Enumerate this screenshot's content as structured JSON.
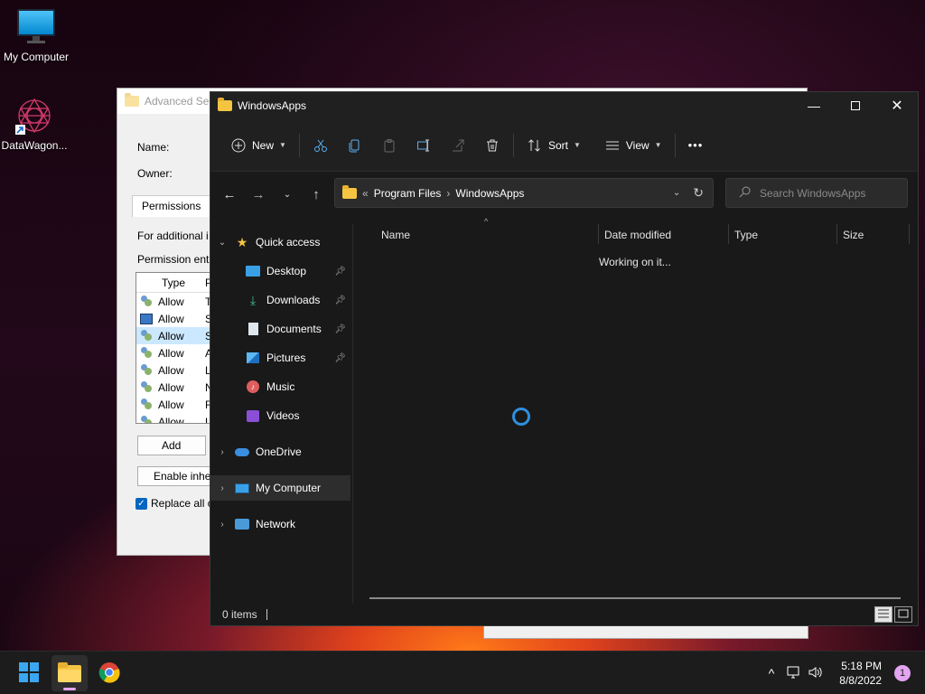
{
  "desktop": {
    "icons": [
      {
        "label": "My Computer"
      },
      {
        "label": "DataWagon..."
      }
    ]
  },
  "background_dialog": {
    "title": "Advanced Sec",
    "name_label": "Name:",
    "owner_label": "Owner:",
    "tab": "Permissions",
    "info_text": "For additional i",
    "entries_label": "Permission entr",
    "list_header": "Type",
    "list_header2": "P",
    "rows": [
      {
        "type": "Allow",
        "p": "T"
      },
      {
        "type": "Allow",
        "p": "S"
      },
      {
        "type": "Allow",
        "p": "S"
      },
      {
        "type": "Allow",
        "p": "A"
      },
      {
        "type": "Allow",
        "p": "L"
      },
      {
        "type": "Allow",
        "p": "N"
      },
      {
        "type": "Allow",
        "p": "R"
      },
      {
        "type": "Allow",
        "p": "L"
      }
    ],
    "add_button": "Add",
    "enable_button": "Enable inhe",
    "replace_checkbox": "Replace all c"
  },
  "explorer": {
    "title": "WindowsApps",
    "toolbar": {
      "new_label": "New",
      "sort_label": "Sort",
      "view_label": "View",
      "more_label": "•••"
    },
    "address": {
      "prefix": "«",
      "crumbs": [
        "Program Files",
        "WindowsApps"
      ]
    },
    "search": {
      "placeholder": "Search WindowsApps"
    },
    "nav": {
      "quick_access": "Quick access",
      "desktop": "Desktop",
      "downloads": "Downloads",
      "documents": "Documents",
      "pictures": "Pictures",
      "music": "Music",
      "videos": "Videos",
      "onedrive": "OneDrive",
      "my_computer": "My Computer",
      "network": "Network"
    },
    "columns": {
      "name": "Name",
      "date": "Date modified",
      "type": "Type",
      "size": "Size"
    },
    "status_text": "Working on it...",
    "items_count": "0 items"
  },
  "taskbar": {
    "time": "5:18 PM",
    "date": "8/8/2022",
    "notification_count": "1"
  },
  "colors": {
    "accent": "#0067c0",
    "spinner": "#2f8fe0",
    "indicator": "#e3a5f0"
  }
}
